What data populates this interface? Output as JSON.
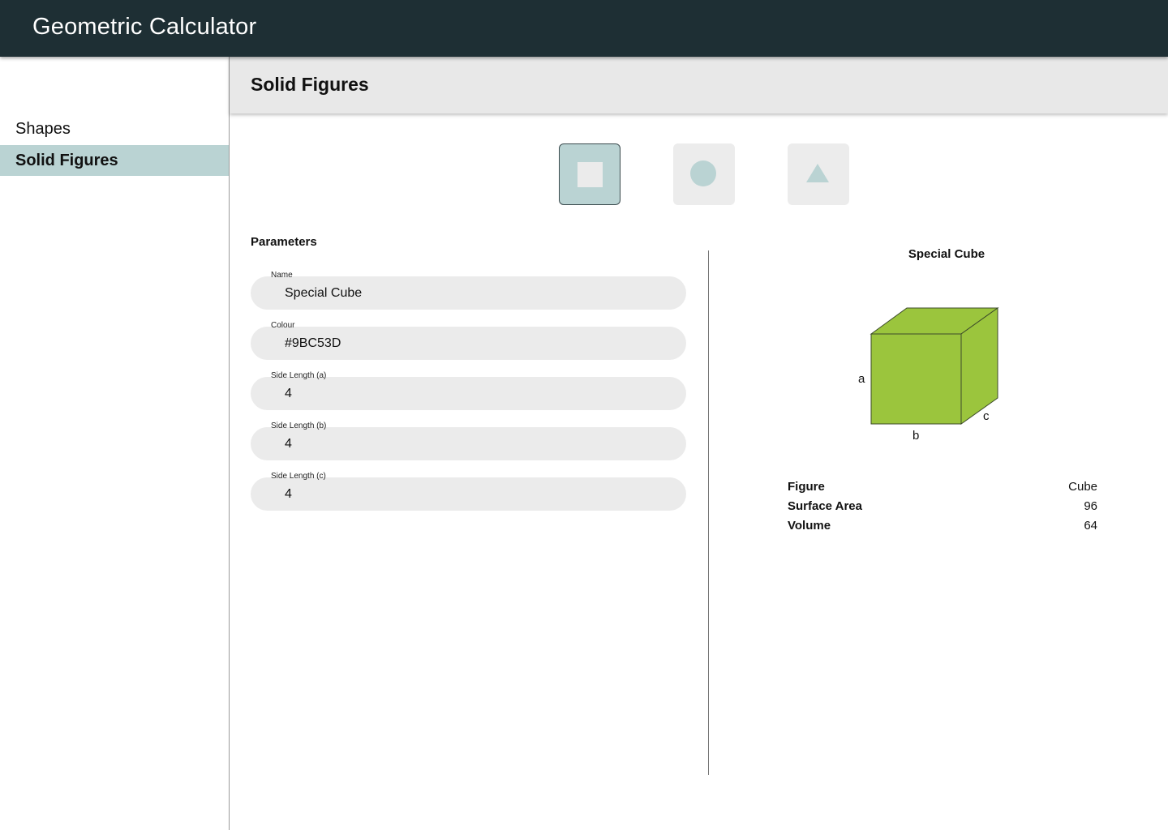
{
  "app": {
    "title": "Geometric Calculator"
  },
  "sidebar": {
    "items": [
      {
        "label": "Shapes",
        "active": false
      },
      {
        "label": "Solid Figures",
        "active": true
      }
    ]
  },
  "page": {
    "title": "Solid Figures"
  },
  "figure_selector": {
    "options": [
      {
        "icon": "square-icon",
        "selected": true
      },
      {
        "icon": "circle-icon",
        "selected": false
      },
      {
        "icon": "triangle-icon",
        "selected": false
      }
    ],
    "selected_bg": "#BAD3D3",
    "icon_color_selected": "#EBEBEB",
    "icon_color": "#BAD3D3"
  },
  "parameters": {
    "label": "Parameters",
    "fields": [
      {
        "label": "Name",
        "value": "Special Cube"
      },
      {
        "label": "Colour",
        "value": "#9BC53D"
      },
      {
        "label": "Side Length (a)",
        "value": "4"
      },
      {
        "label": "Side Length (b)",
        "value": "4"
      },
      {
        "label": "Side Length (c)",
        "value": "4"
      }
    ]
  },
  "preview": {
    "title": "Special Cube",
    "fill_color": "#9BC53D",
    "edge_labels": {
      "a": "a",
      "b": "b",
      "c": "c"
    }
  },
  "results": [
    {
      "key": "Figure",
      "value": "Cube"
    },
    {
      "key": "Surface Area",
      "value": "96"
    },
    {
      "key": "Volume",
      "value": "64"
    }
  ],
  "colors": {
    "header_bg": "#1E2F34",
    "sidebar_active_bg": "#BAD3D3",
    "page_header_bg": "#E8E8E8",
    "field_bg": "#EBEBEB"
  }
}
